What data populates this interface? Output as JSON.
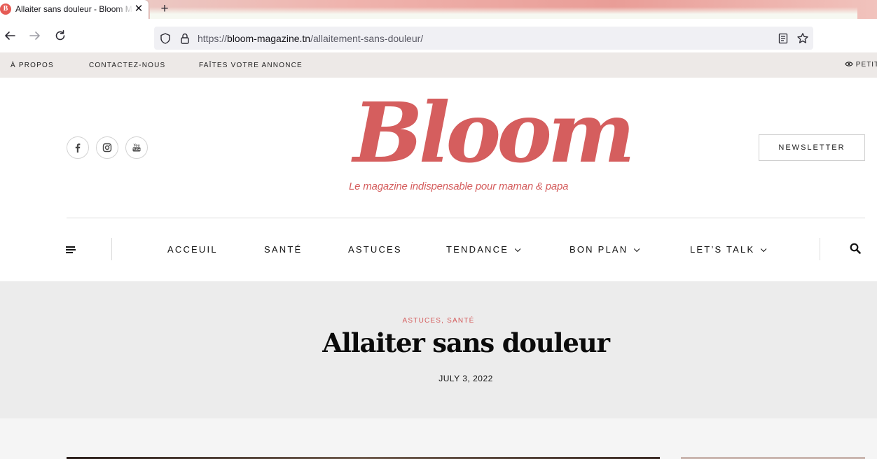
{
  "browser": {
    "tab_title": "Allaiter sans douleur - Bloom Magazine",
    "tab_favicon": "B",
    "tab_close": "✕",
    "new_tab": "+",
    "url_scheme": "https://",
    "url_domain": "bloom-magazine.tn",
    "url_path": "/allaitement-sans-douleur/"
  },
  "topbar": {
    "links": [
      "À PROPOS",
      "CONTACTEZ-NOUS",
      "FAÎTES VOTRE ANNONCE"
    ],
    "right_label": "PETIT"
  },
  "header": {
    "logo": "Bloom",
    "tagline": "Le magazine indispensable pour maman & papa",
    "newsletter": "NEWSLETTER",
    "social_icons": [
      "facebook-icon",
      "instagram-icon",
      "youtube-icon"
    ]
  },
  "nav": {
    "items": [
      {
        "label": "ACCEUIL",
        "dropdown": false
      },
      {
        "label": "SANTÉ",
        "dropdown": false
      },
      {
        "label": "ASTUCES",
        "dropdown": false
      },
      {
        "label": "TENDANCE",
        "dropdown": true
      },
      {
        "label": "BON PLAN",
        "dropdown": true
      },
      {
        "label": "LET’S TALK",
        "dropdown": true
      }
    ]
  },
  "post": {
    "categories": "ASTUCES, SANTÉ",
    "title": "Allaiter sans douleur",
    "date": "JULY 3, 2022"
  },
  "colors": {
    "brand": "#d55e5e",
    "topbar_bg": "#ede9e7",
    "hero_bg": "#ececec"
  }
}
